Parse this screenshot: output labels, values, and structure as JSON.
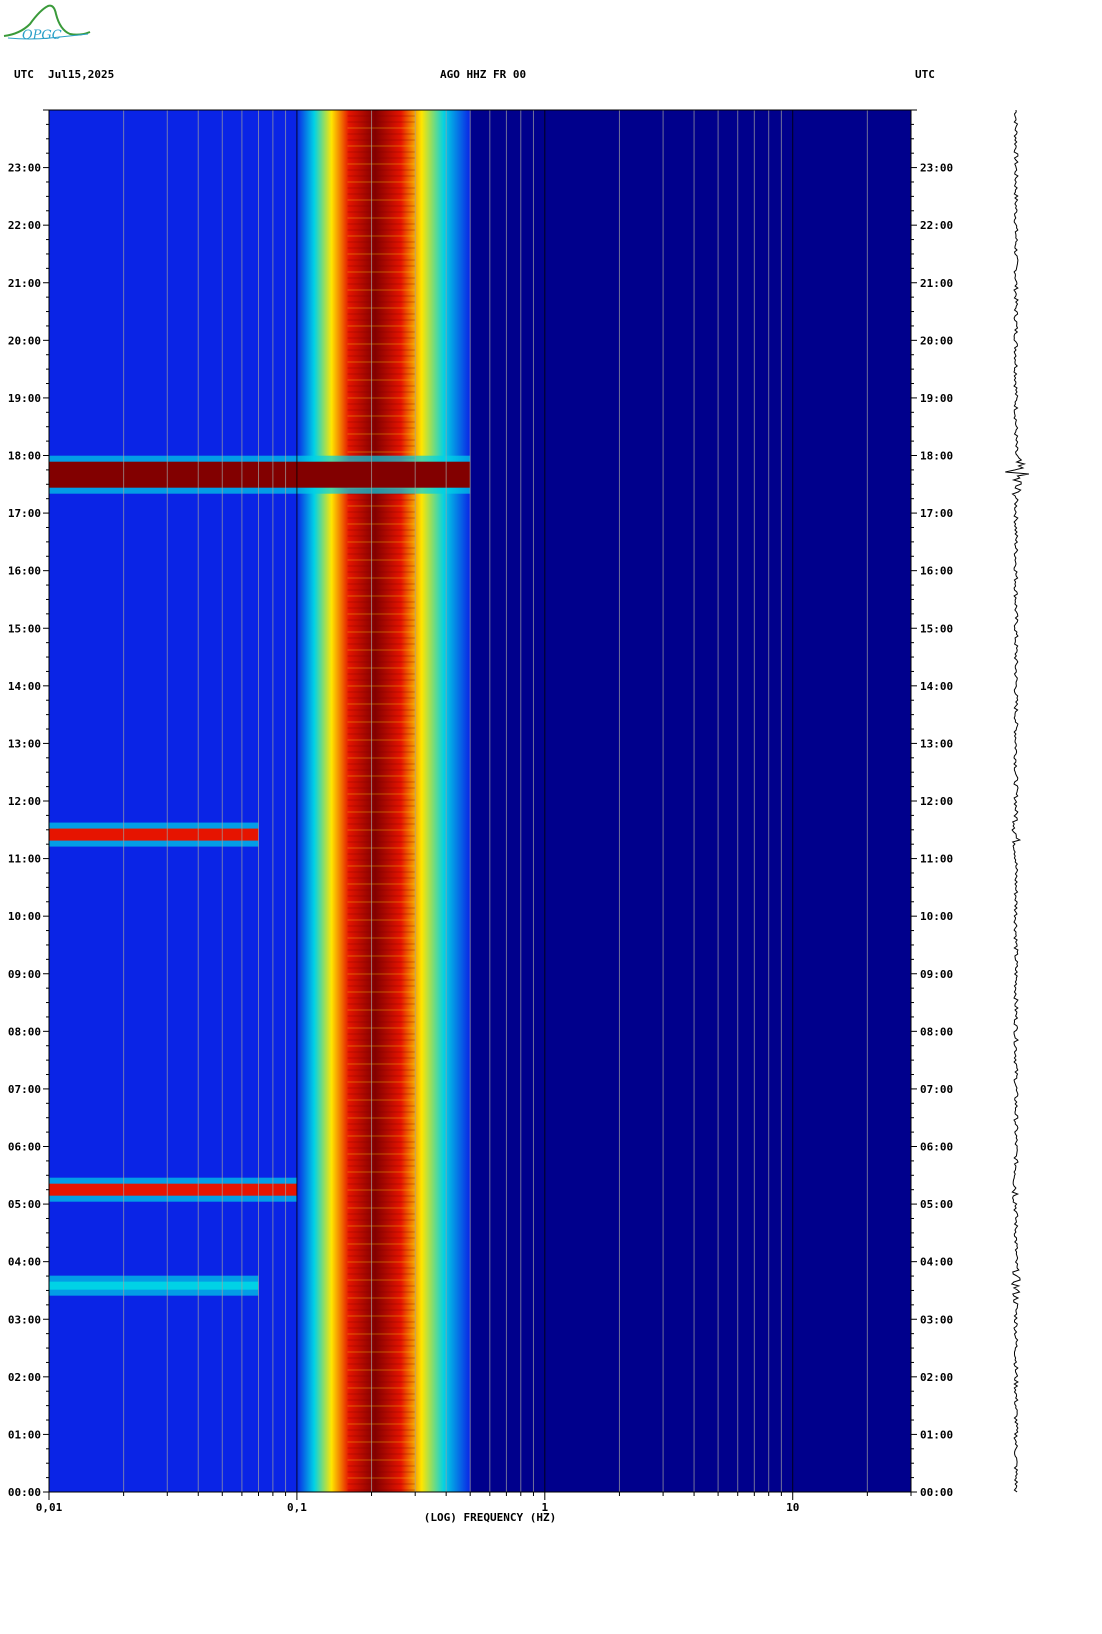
{
  "header": {
    "left_tz": "UTC",
    "date": "Jul15,2025",
    "station": "AGO HHZ FR 00",
    "right_tz": "UTC"
  },
  "logo": {
    "name": "OPGC",
    "text": "OPGC"
  },
  "colors": {
    "background": "#00008c",
    "lowband": "#0a24e6",
    "cyan": "#00d2e6",
    "yellow": "#ffe600",
    "red": "#e61400",
    "darkred": "#820000",
    "grid": "#a0a0a0"
  },
  "chart_data": {
    "type": "heatmap",
    "title": "AGO HHZ FR 00",
    "xlabel": "(LOG) FREQUENCY (HZ)",
    "ylabel": "UTC",
    "xscale": "log",
    "xlim": [
      0.01,
      30
    ],
    "ylim_hours": [
      0,
      24
    ],
    "x_tick_labels": [
      "0,01",
      "0,1",
      "1",
      "10"
    ],
    "y_tick_labels": [
      "00:00",
      "01:00",
      "02:00",
      "03:00",
      "04:00",
      "05:00",
      "06:00",
      "07:00",
      "08:00",
      "09:00",
      "10:00",
      "11:00",
      "12:00",
      "13:00",
      "14:00",
      "15:00",
      "16:00",
      "17:00",
      "18:00",
      "19:00",
      "20:00",
      "21:00",
      "22:00",
      "23:00"
    ],
    "microseism_peak_hz": 0.2,
    "microseism_band_hz": [
      0.15,
      0.35
    ],
    "events": [
      {
        "time_utc": "03:35",
        "freq_range_hz": [
          0.01,
          0.07
        ],
        "level": "cyan"
      },
      {
        "time_utc": "05:15",
        "freq_range_hz": [
          0.01,
          0.1
        ],
        "level": "red"
      },
      {
        "time_utc": "11:25",
        "freq_range_hz": [
          0.01,
          0.07
        ],
        "level": "red"
      },
      {
        "time_utc": "17:40",
        "freq_range_hz": [
          0.01,
          0.5
        ],
        "level": "darkred"
      }
    ]
  }
}
